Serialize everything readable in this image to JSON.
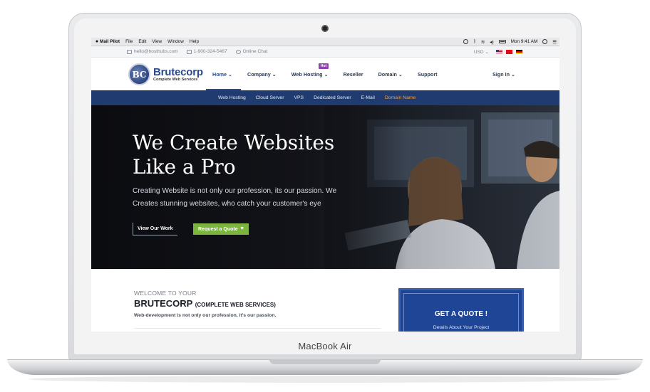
{
  "device": {
    "label": "MacBook Air"
  },
  "menubar": {
    "app_name": "Mail Pilot",
    "items": [
      "File",
      "Edit",
      "View",
      "Window",
      "Help"
    ],
    "clock": "Mon 9:41 AM"
  },
  "topbar": {
    "email": "hello@hosthubs.com",
    "phone": "1-900-324-5467",
    "chat": "Online Chat",
    "currency": "USD"
  },
  "brand": {
    "initials": "BC",
    "name": "Brutecorp",
    "tagline": "Complete Web Services"
  },
  "nav": {
    "items": [
      {
        "label": "Home ⌄"
      },
      {
        "label": "Company ⌄"
      },
      {
        "label": "Web Hosting ⌄",
        "badge": "Hot"
      },
      {
        "label": "Reseller"
      },
      {
        "label": "Domain ⌄"
      },
      {
        "label": "Support"
      }
    ],
    "signin": "Sign In ⌄"
  },
  "subnav": {
    "items": [
      "Web Hosting",
      "Cloud Server",
      "VPS",
      "Dedicated Server",
      "E-Mail",
      "Domain Name"
    ]
  },
  "hero": {
    "title_line1": "We Create Websites",
    "title_line2": "Like a Pro",
    "desc_line1": "Creating Website is not only our profession, its our passion. We",
    "desc_line2": "Creates stunning websites, who catch your customer's eye",
    "btn_primary": "View Our Work",
    "btn_secondary": "Request a Quote"
  },
  "welcome": {
    "kicker": "WELCOME TO YOUR",
    "title": "BRUTECORP",
    "title_small": "(COMPLETE WEB SERVICES)",
    "line": "Web-development is not only our profession, it's our passion."
  },
  "quote": {
    "title": "GET A QUOTE !",
    "subtitle": "Details About Your Project"
  },
  "colors": {
    "brand_blue": "#2b4a8b",
    "subnav_bg": "#1f3b6f",
    "accent_orange": "#f0a045",
    "cta_green": "#7cb53d",
    "quote_bg": "#1f4597",
    "hot_badge": "#8e44ad"
  }
}
